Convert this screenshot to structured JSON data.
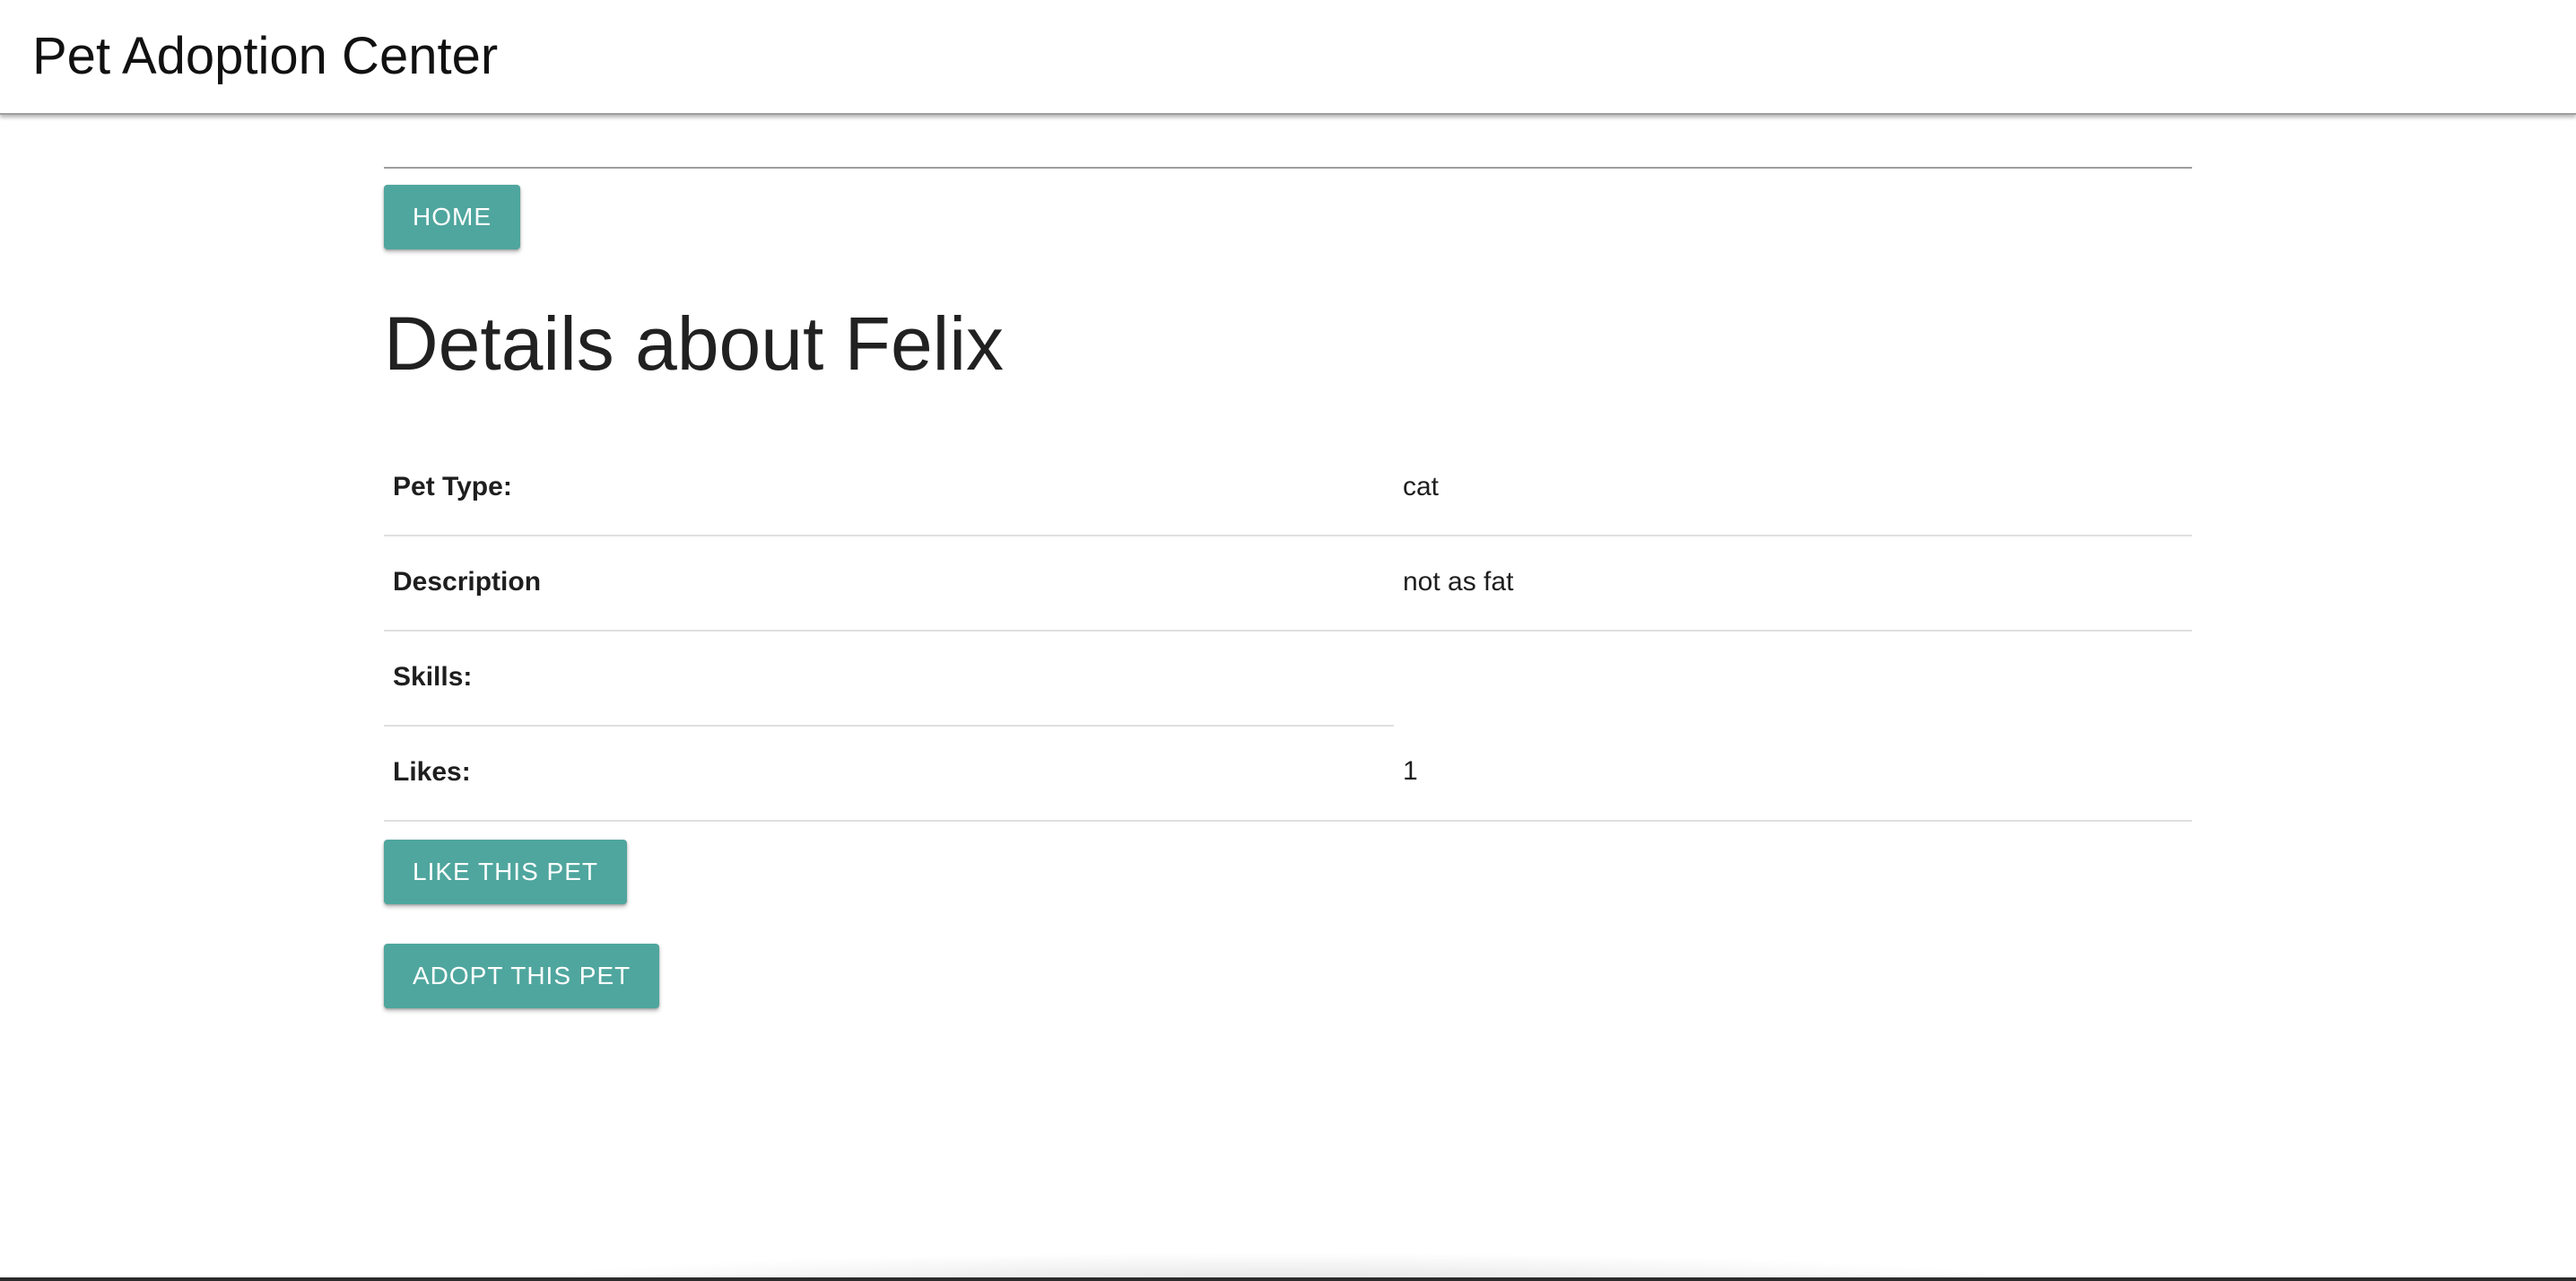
{
  "app": {
    "title": "Pet Adoption Center"
  },
  "nav": {
    "home_label": "HOME"
  },
  "page": {
    "title": "Details about Felix"
  },
  "details": [
    {
      "label": "Pet Type:",
      "value": "cat"
    },
    {
      "label": "Description",
      "value": "not as fat"
    },
    {
      "label": "Skills:",
      "value": ""
    },
    {
      "label": "Likes:",
      "value": "1"
    }
  ],
  "actions": {
    "like_label": "LIKE THIS PET",
    "adopt_label": "ADOPT THIS PET"
  },
  "colors": {
    "accent": "#4fa69e"
  }
}
